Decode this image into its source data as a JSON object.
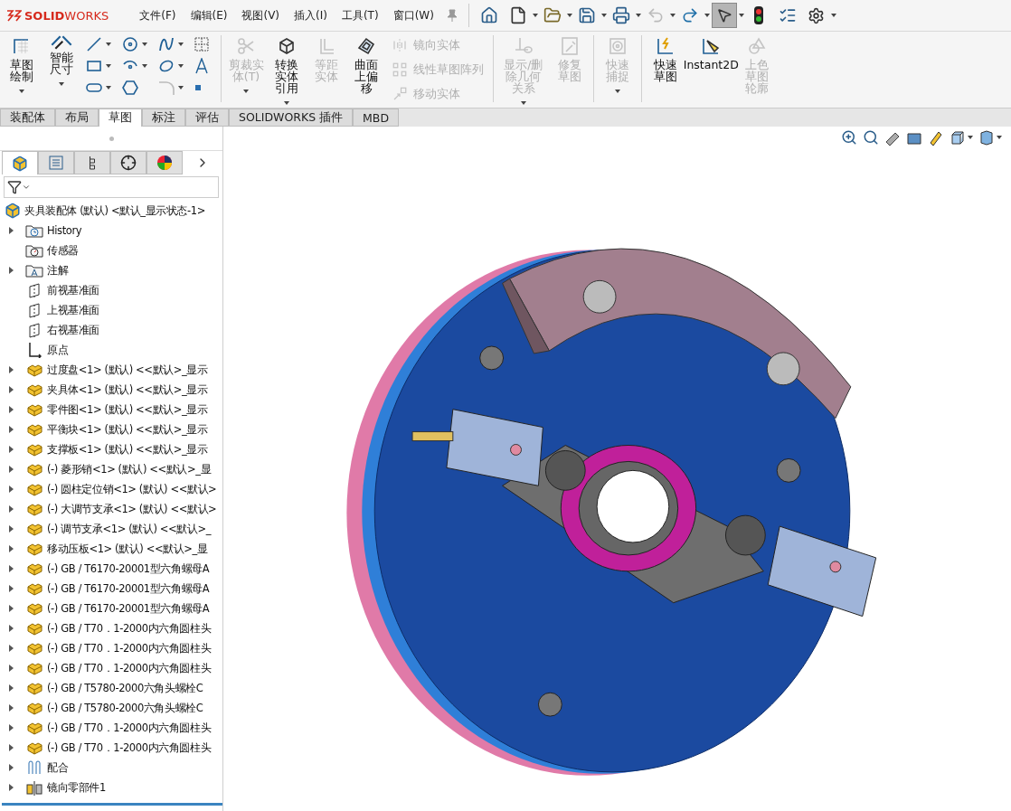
{
  "logo": "**SOLID**WORKS",
  "menu": [
    "文件(F)",
    "编辑(E)",
    "视图(V)",
    "插入(I)",
    "工具(T)",
    "窗口(W)"
  ],
  "quick_tools": [
    {
      "selected": false
    },
    {
      "selected": false
    },
    {
      "selected": false
    },
    {
      "selected": false
    },
    {
      "selected": false
    },
    {
      "selected": false
    },
    {
      "selected": false
    },
    {
      "selected": true
    },
    {
      "selected": false
    },
    {
      "selected": false
    },
    {
      "selected": false
    }
  ],
  "ribbon": [
    {
      "kind": "large",
      "label": "草图绘制",
      "disabled": false,
      "dropdown": true
    },
    {
      "kind": "large",
      "label": "智能尺寸",
      "disabled": false,
      "dropdown": true
    },
    {
      "kind": "tools"
    },
    {
      "kind": "separator"
    },
    {
      "kind": "large",
      "label": "剪裁实体(T)",
      "disabled": true,
      "dropdown": true
    },
    {
      "kind": "large",
      "label": "转换实体引用",
      "disabled": false,
      "dropdown": true
    },
    {
      "kind": "large",
      "label": "等距实体",
      "disabled": true,
      "dropdown": false
    },
    {
      "kind": "large",
      "label": "曲面上偏移",
      "disabled": false,
      "dropdown": false
    },
    {
      "kind": "stack",
      "items": [
        {
          "label": "镜向实体",
          "disabled": true
        },
        {
          "label": "线性草图阵列",
          "disabled": true
        },
        {
          "label": "移动实体",
          "disabled": true
        }
      ]
    },
    {
      "kind": "separator"
    },
    {
      "kind": "large",
      "label": "显示/删除几何关系",
      "disabled": true,
      "dropdown": true
    },
    {
      "kind": "large",
      "label": "修复草图",
      "disabled": true,
      "dropdown": false
    },
    {
      "kind": "separator"
    },
    {
      "kind": "large",
      "label": "快速捕捉",
      "disabled": true,
      "dropdown": true
    },
    {
      "kind": "separator"
    },
    {
      "kind": "large",
      "label": "快速草图",
      "disabled": false,
      "dropdown": false
    },
    {
      "kind": "large",
      "label": "Instant2D",
      "disabled": false,
      "dropdown": false
    },
    {
      "kind": "large",
      "label": "上色草图轮廓",
      "disabled": true,
      "dropdown": false
    }
  ],
  "tabs": [
    {
      "label": "装配体",
      "selected": false
    },
    {
      "label": "布局",
      "selected": false
    },
    {
      "label": "草图",
      "selected": true
    },
    {
      "label": "标注",
      "selected": false
    },
    {
      "label": "评估",
      "selected": false
    },
    {
      "label": "SOLIDWORKS 插件",
      "selected": false
    },
    {
      "label": "MBD",
      "selected": false
    }
  ],
  "panel_tabs": [
    {
      "selected": true
    },
    {
      "selected": false
    },
    {
      "selected": false
    },
    {
      "selected": false
    },
    {
      "selected": false
    }
  ],
  "tree": {
    "label": "夹具装配体 (默认) <默认_显示状态-1>",
    "children": [
      {
        "kind": "folder",
        "label": "History",
        "expandable": true
      },
      {
        "kind": "folder",
        "label": "传感器",
        "expandable": false
      },
      {
        "kind": "folder",
        "label": "注解",
        "expandable": true
      },
      {
        "kind": "plane",
        "label": "前视基准面",
        "expandable": false
      },
      {
        "kind": "plane",
        "label": "上视基准面",
        "expandable": false
      },
      {
        "kind": "plane",
        "label": "右视基准面",
        "expandable": false
      },
      {
        "kind": "origin",
        "label": "原点",
        "expandable": false
      },
      {
        "kind": "part",
        "label": "过度盘<1> (默认) <<默认>_显示",
        "expandable": true
      },
      {
        "kind": "part",
        "label": "夹具体<1> (默认) <<默认>_显示",
        "expandable": true
      },
      {
        "kind": "part",
        "label": "零件图<1> (默认) <<默认>_显示",
        "expandable": true
      },
      {
        "kind": "part",
        "label": "平衡块<1> (默认) <<默认>_显示",
        "expandable": true
      },
      {
        "kind": "part",
        "label": "支撑板<1> (默认) <<默认>_显示",
        "expandable": true
      },
      {
        "kind": "part",
        "label": "(-) 菱形销<1> (默认) <<默认>_显",
        "expandable": true
      },
      {
        "kind": "part",
        "label": "(-) 圆柱定位销<1> (默认) <<默认>",
        "expandable": true
      },
      {
        "kind": "part",
        "label": "(-) 大调节支承<1> (默认) <<默认>",
        "expandable": true
      },
      {
        "kind": "part",
        "label": "(-) 调节支承<1> (默认) <<默认>_",
        "expandable": true
      },
      {
        "kind": "part",
        "label": "移动压板<1> (默认) <<默认>_显",
        "expandable": true
      },
      {
        "kind": "part",
        "label": "(-) GB / T6170-20001型六角螺母A",
        "expandable": true
      },
      {
        "kind": "part",
        "label": "(-) GB / T6170-20001型六角螺母A",
        "expandable": true
      },
      {
        "kind": "part",
        "label": "(-) GB / T6170-20001型六角螺母A",
        "expandable": true
      },
      {
        "kind": "part",
        "label": "(-) GB / T70．1-2000内六角圆柱头",
        "expandable": true
      },
      {
        "kind": "part",
        "label": "(-) GB / T70．1-2000内六角圆柱头",
        "expandable": true
      },
      {
        "kind": "part",
        "label": "(-) GB / T70．1-2000内六角圆柱头",
        "expandable": true
      },
      {
        "kind": "part",
        "label": "(-) GB / T5780-2000六角头螺栓C",
        "expandable": true
      },
      {
        "kind": "part",
        "label": "(-) GB / T5780-2000六角头螺栓C",
        "expandable": true
      },
      {
        "kind": "part",
        "label": "(-) GB / T70．1-2000内六角圆柱头",
        "expandable": true
      },
      {
        "kind": "part",
        "label": "(-) GB / T70．1-2000内六角圆柱头",
        "expandable": true
      },
      {
        "kind": "mates",
        "label": "配合",
        "expandable": true
      },
      {
        "kind": "mirror",
        "label": "镜向零部件1",
        "expandable": true
      }
    ]
  }
}
